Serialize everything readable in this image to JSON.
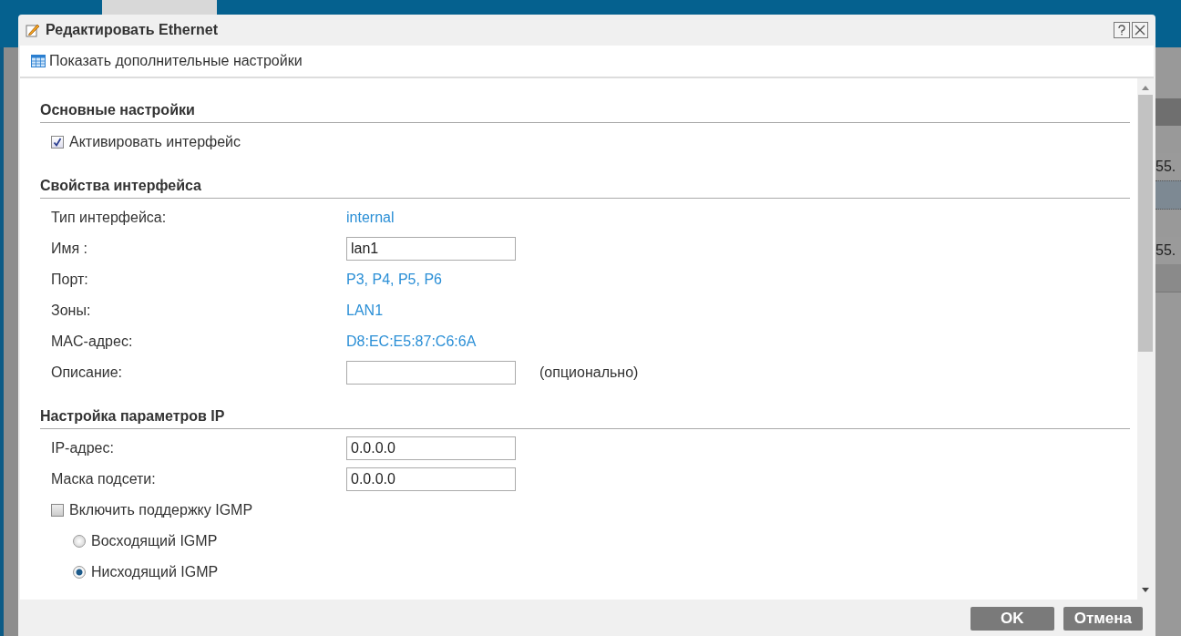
{
  "background": {
    "cells": [
      "55.",
      "55."
    ]
  },
  "dialog": {
    "title": "Редактировать Ethernet",
    "toolbar_link": "Показать дополнительные настройки",
    "sections": [
      {
        "title": "Основные настройки",
        "rows": [
          {
            "kind": "checkbox",
            "label": "Активировать интерфейс",
            "checked": true
          }
        ]
      },
      {
        "title": "Свойства интерфейса",
        "rows": [
          {
            "kind": "text",
            "label": "Тип интерфейса:",
            "value": "internal"
          },
          {
            "kind": "input",
            "label": "Имя :",
            "value": "lan1"
          },
          {
            "kind": "text",
            "label": "Порт:",
            "value": "P3, P4, P5, P6"
          },
          {
            "kind": "text",
            "label": "Зоны:",
            "value": "LAN1"
          },
          {
            "kind": "text",
            "label": "MAC-адрес:",
            "value": "D8:EC:E5:87:C6:6A"
          },
          {
            "kind": "input",
            "label": "Описание:",
            "value": "",
            "note": "(опционально)"
          }
        ]
      },
      {
        "title": "Настройка параметров IP",
        "rows": [
          {
            "kind": "input",
            "label": "IP-адрес:",
            "value": "0.0.0.0"
          },
          {
            "kind": "input",
            "label": "Маска подсети:",
            "value": "0.0.0.0"
          },
          {
            "kind": "checkbox",
            "label": "Включить поддержку IGMP",
            "checked": false
          },
          {
            "kind": "radio",
            "label": "Восходящий IGMP",
            "selected": false
          },
          {
            "kind": "radio",
            "label": "Нисходящий IGMP",
            "selected": true
          }
        ]
      }
    ],
    "buttons": [
      "OK",
      "Отмена"
    ]
  }
}
